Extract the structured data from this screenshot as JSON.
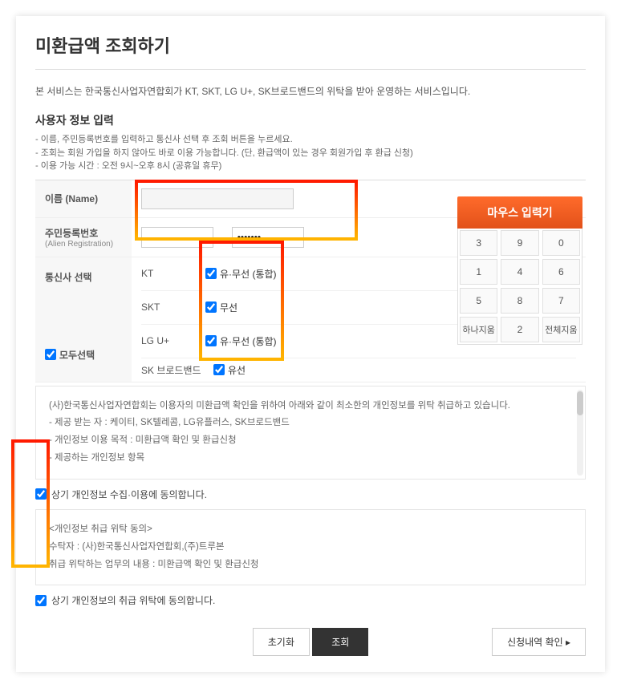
{
  "title": "미환급액 조회하기",
  "intro": "본 서비스는 한국통신사업자연합회가 KT, SKT, LG U+, SK브로드밴드의 위탁을 받아 운영하는 서비스입니다.",
  "section_title": "사용자 정보 입력",
  "notes": [
    "- 이름, 주민등록번호를 입력하고 통신사 선택 후 조회 버튼을 누르세요.",
    "- 조회는 회원 가입을 하지 않아도 바로 이용 가능합니다. (단, 환급액이 있는 경우 회원가입 후 환급 신청)",
    "- 이용 가능 시간 : 오전 9시~오후 8시 (공휴일 휴무)"
  ],
  "form": {
    "name_label": "이름 (Name)",
    "rrn_label": "주민등록번호",
    "rrn_sub": "(Alien Registration)",
    "rrn2_value": "•••••••",
    "carrier_label": "통신사 선택",
    "select_all": "모두선택",
    "carriers": [
      {
        "name": "KT",
        "option": "유·무선 (통합)"
      },
      {
        "name": "SKT",
        "option": "무선"
      },
      {
        "name": "LG U+",
        "option": "유·무선 (통합)"
      },
      {
        "name": "SK 브로드밴드",
        "option": "유선"
      }
    ]
  },
  "keypad": {
    "title": "마우스 입력기",
    "keys": [
      [
        "3",
        "9",
        "0"
      ],
      [
        "1",
        "4",
        "6"
      ],
      [
        "5",
        "8",
        "7"
      ]
    ],
    "clear_one": "하나지움",
    "num2": "2",
    "clear_all": "전체지움"
  },
  "info1": {
    "lines": [
      "(사)한국통신사업자연합회는 이용자의 미환급액 확인을 위하여 아래와 같이 최소한의 개인정보를 위탁 취급하고 있습니다.",
      "- 제공 받는 자 : 케이티, SK텔레콤, LG유플러스, SK브로드밴드",
      "- 개인정보 이용 목적 : 미환급액 확인 및 환급신청",
      "- 제공하는 개인정보 항목"
    ]
  },
  "consent1": "상기 개인정보 수집·이용에 동의합니다.",
  "info2": {
    "lines": [
      "<개인정보 취급 위탁 동의>",
      "수탁자 : (사)한국통신사업자연합회,(주)트루본",
      "취급 위탁하는 업무의 내용 : 미환급액 확인 및 환급신청"
    ]
  },
  "consent2": "상기 개인정보의 취급 위탁에 동의합니다.",
  "buttons": {
    "reset": "초기화",
    "search": "조회",
    "history": "신청내역 확인"
  }
}
